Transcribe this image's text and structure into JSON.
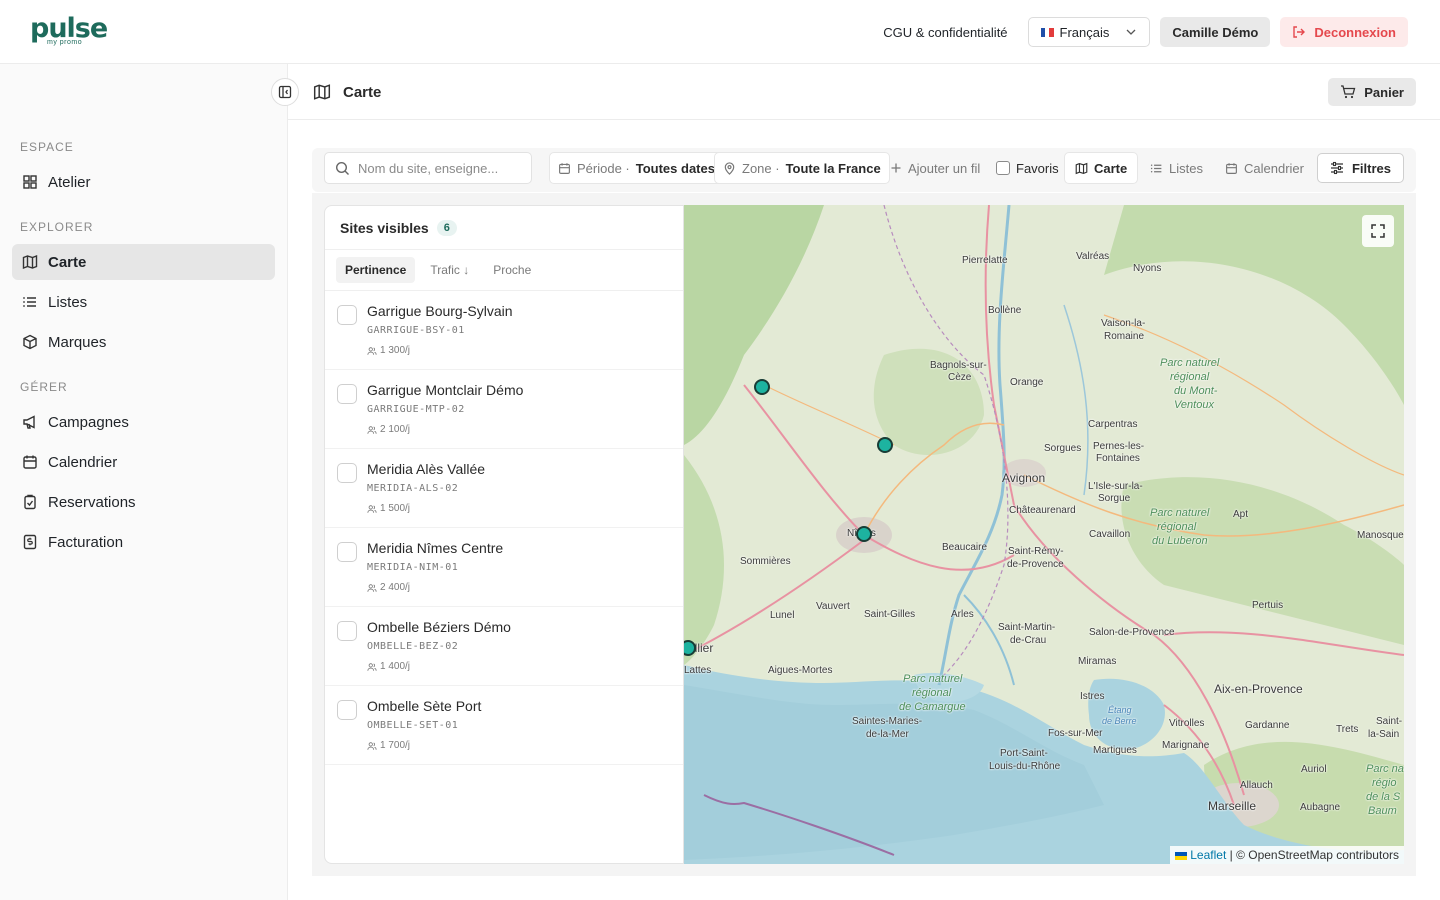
{
  "brand": {
    "logo_text": "pulse",
    "logo_sub": "my promo"
  },
  "topbar": {
    "cgu_link": "CGU & confidentialité",
    "language": "Français",
    "user": "Camille Démo",
    "logout": "Deconnexion"
  },
  "sidebar": {
    "sections": {
      "espace": "ESPACE",
      "explorer": "EXPLORER",
      "gerer": "GÉRER"
    },
    "items": [
      {
        "label": "Atelier",
        "icon": "grid-icon"
      },
      {
        "label": "Carte",
        "icon": "map-icon",
        "active": true
      },
      {
        "label": "Listes",
        "icon": "list-icon"
      },
      {
        "label": "Marques",
        "icon": "box-icon"
      },
      {
        "label": "Campagnes",
        "icon": "megaphone-icon"
      },
      {
        "label": "Calendrier",
        "icon": "calendar-icon"
      },
      {
        "label": "Reservations",
        "icon": "clipboard-icon"
      },
      {
        "label": "Facturation",
        "icon": "receipt-icon"
      }
    ]
  },
  "header": {
    "title": "Carte",
    "cart": "Panier"
  },
  "filters": {
    "search_placeholder": "Nom du site, enseigne...",
    "period_label": "Période ·",
    "period_value": "Toutes dates",
    "zone_label": "Zone ·",
    "zone_value": "Toute la France",
    "add_filter": "Ajouter un fil",
    "favorites": "Favoris",
    "view_map": "Carte",
    "view_lists": "Listes",
    "view_calendar": "Calendrier",
    "filters_button": "Filtres"
  },
  "panel": {
    "title": "Sites visibles",
    "count": "6",
    "tabs": [
      "Pertinence",
      "Trafic ↓",
      "Proche"
    ],
    "sites": [
      {
        "name": "Garrigue Bourg-Sylvain",
        "code": "GARRIGUE-BSY-01",
        "traffic": "1 300/j"
      },
      {
        "name": "Garrigue Montclair Démo",
        "code": "GARRIGUE-MTP-02",
        "traffic": "2 100/j"
      },
      {
        "name": "Meridia Alès Vallée",
        "code": "MERIDIA-ALS-02",
        "traffic": "1 500/j"
      },
      {
        "name": "Meridia Nîmes Centre",
        "code": "MERIDIA-NIM-01",
        "traffic": "2 400/j"
      },
      {
        "name": "Ombelle Béziers Démo",
        "code": "OMBELLE-BEZ-02",
        "traffic": "1 400/j"
      },
      {
        "name": "Ombelle Sète Port",
        "code": "OMBELLE-SET-01",
        "traffic": "1 700/j"
      }
    ]
  },
  "map": {
    "attribution_leaflet": "Leaflet",
    "attribution_rest": " | © OpenStreetMap contributors",
    "labels": {
      "pierrelatte": "Pierrelatte",
      "valreas": "Valréas",
      "nyons": "Nyons",
      "bollene": "Bollène",
      "vaison": "Vaison-la-",
      "vaison2": "Romaine",
      "bagnols": "Bagnols-sur-",
      "bagnols2": "Cèze",
      "orange": "Orange",
      "carpentras": "Carpentras",
      "pernes": "Pernes-les-",
      "pernes2": "Fontaines",
      "sorgues": "Sorgues",
      "avignon": "Avignon",
      "lisle": "L'Isle-sur-la-",
      "lisle2": "Sorgue",
      "chateaurenard": "Châteaurenard",
      "cavaillon": "Cavaillon",
      "apt": "Apt",
      "manosque": "Manosque",
      "nimes": "Nîmes",
      "beaucaire": "Beaucaire",
      "saintremy": "Saint-Rémy-",
      "saintremy2": "de-Provence",
      "sommieres": "Sommières",
      "vauvert": "Vauvert",
      "lunel": "Lunel",
      "saintgilles": "Saint-Gilles",
      "arles": "Arles",
      "saintmartin": "Saint-Martin-",
      "saintmartin2": "de-Crau",
      "salon": "Salon-de-Provence",
      "pertuis": "Pertuis",
      "miramas": "Miramas",
      "aix": "Aix-en-Provence",
      "montpellier": "ellier",
      "lattes": "Lattes",
      "aigues": "Aigues-Mortes",
      "istres": "Istres",
      "saintesmaries": "Saintes-Maries-",
      "saintesmaries2": "de-la-Mer",
      "fos": "Fos-sur-Mer",
      "vitrolles": "Vitrolles",
      "gardanne": "Gardanne",
      "trets": "Trets",
      "martigues": "Martigues",
      "marignane": "Marignane",
      "portsaint": "Port-Saint-",
      "portsaint2": "Louis-du-Rhône",
      "auriol": "Auriol",
      "allauch": "Allauch",
      "marseille": "Marseille",
      "aubagne": "Aubagne",
      "saintmax": "Saint-",
      "saintmax2": "la-Sain",
      "etang": "Étang",
      "etang2": "de Berre",
      "park_ventoux": "Parc naturel",
      "park_ventoux2": "régional",
      "park_ventoux3": "du Mont-",
      "park_ventoux4": "Ventoux",
      "park_luberon": "Parc naturel",
      "park_luberon2": "régional",
      "park_luberon3": "du Luberon",
      "park_camargue": "Parc naturel",
      "park_camargue2": "régional",
      "park_camargue3": "de Camargue",
      "park_baume": "Parc na",
      "park_baume2": "régio",
      "park_baume3": "de la S",
      "park_baume4": "Baum"
    }
  },
  "colors": {
    "accent": "#1e6b5c",
    "marker": "#1db3a0",
    "danger": "#e5484d",
    "sea": "#aad3df",
    "land": "#e6ecd9"
  }
}
